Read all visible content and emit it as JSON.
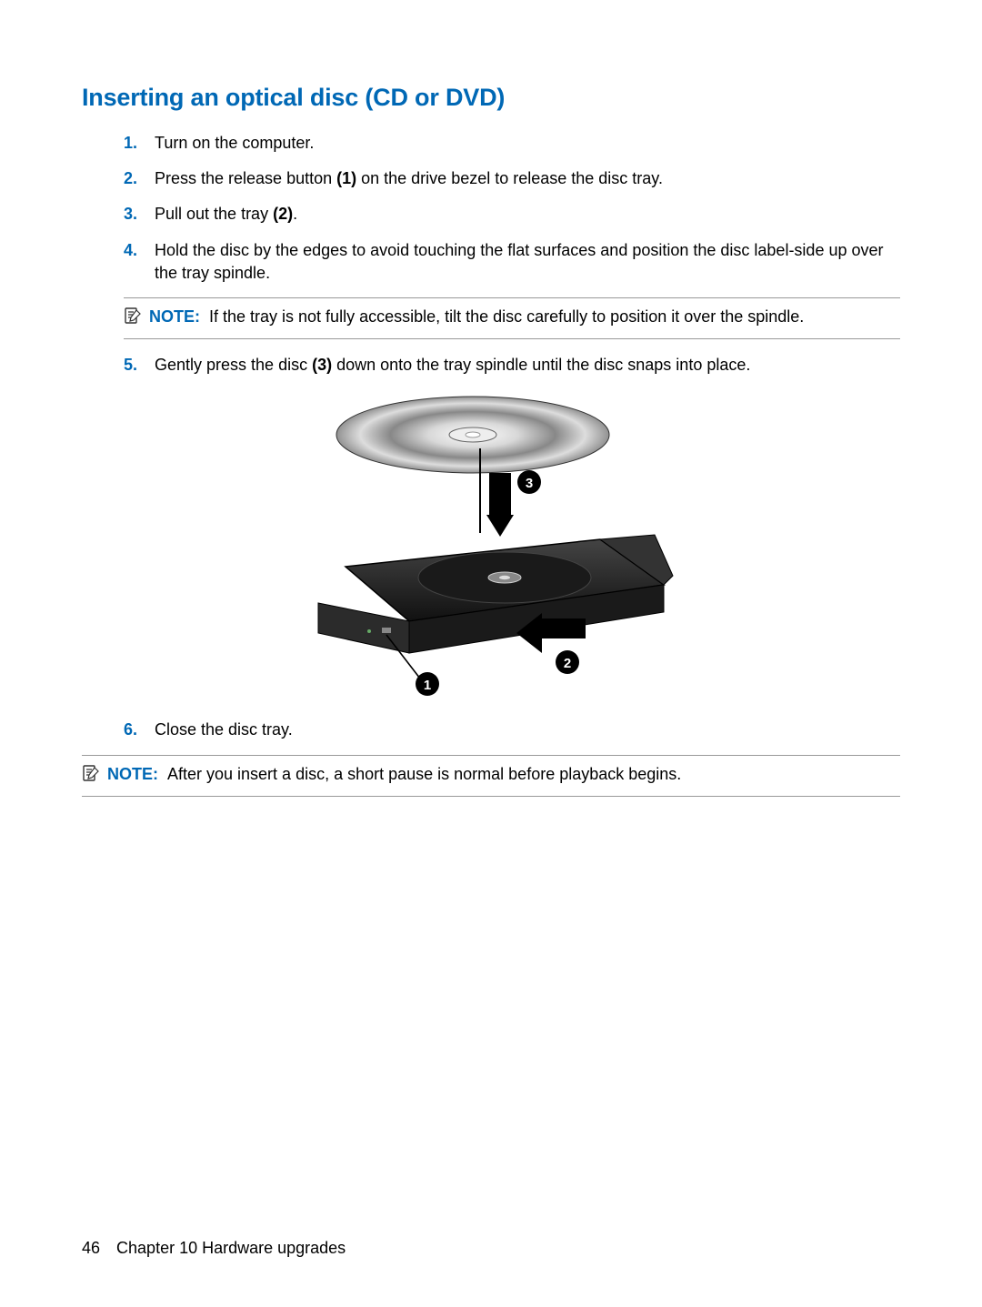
{
  "heading": "Inserting an optical disc (CD or DVD)",
  "steps": {
    "s1": {
      "num": "1.",
      "text": "Turn on the computer."
    },
    "s2": {
      "num": "2.",
      "text_before": "Press the release button ",
      "bold1": "(1)",
      "text_after": " on the drive bezel to release the disc tray."
    },
    "s3": {
      "num": "3.",
      "text_before": "Pull out the tray ",
      "bold1": "(2)",
      "text_after": "."
    },
    "s4": {
      "num": "4.",
      "text": "Hold the disc by the edges to avoid touching the flat surfaces and position the disc label-side up over the tray spindle."
    },
    "s5": {
      "num": "5.",
      "text_before": "Gently press the disc ",
      "bold1": "(3)",
      "text_after": " down onto the tray spindle until the disc snaps into place."
    },
    "s6": {
      "num": "6.",
      "text": "Close the disc tray."
    }
  },
  "note1": {
    "label": "NOTE:",
    "text": "If the tray is not fully accessible, tilt the disc carefully to position it over the spindle."
  },
  "note2": {
    "label": "NOTE:",
    "text": "After you insert a disc, a short pause is normal before playback begins."
  },
  "illustration": {
    "callout1": "1",
    "callout2": "2",
    "callout3": "3"
  },
  "footer": {
    "page": "46",
    "chapter": "Chapter 10   Hardware upgrades"
  }
}
